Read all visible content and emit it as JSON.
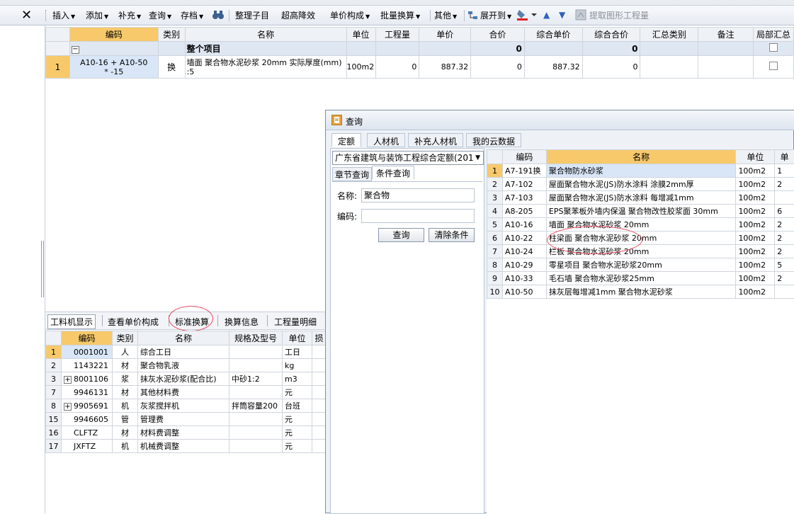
{
  "toolbar": {
    "items": [
      "插入",
      "添加",
      "补充",
      "查询",
      "存档",
      "整理子目",
      "超高降效",
      "单价构成",
      "批量换算",
      "其他",
      "展开到",
      "提取图形工程量"
    ]
  },
  "main_grid": {
    "headers": [
      "编码",
      "类别",
      "名称",
      "单位",
      "工程量",
      "单价",
      "合价",
      "综合单价",
      "综合合价",
      "汇总类别",
      "备注",
      "局部汇总"
    ],
    "group_row": {
      "name": "整个项目",
      "total": "0",
      "comp_total": "0"
    },
    "rows": [
      {
        "num": "1",
        "code_line1": "A10-16 + A10-50",
        "code_line2": "* -15",
        "type": "换",
        "name_line1": "墙面 聚合物水泥砂浆 20mm 实际厚度(mm)",
        "name_line2": ":5",
        "unit": "100m2",
        "qty": "0",
        "price": "887.32",
        "total": "0",
        "comp_price": "887.32",
        "comp_total": "0"
      }
    ]
  },
  "bottom_tabs": [
    "工料机显示",
    "查看单价构成",
    "标准换算",
    "换算信息",
    "工程量明细"
  ],
  "bottom_grid": {
    "headers": [
      "编码",
      "类别",
      "名称",
      "规格及型号",
      "单位",
      "损"
    ],
    "rows": [
      {
        "num": "1",
        "expand": "",
        "code": "0001001",
        "type": "人",
        "name": "综合工日",
        "spec": "",
        "unit": "工日"
      },
      {
        "num": "2",
        "expand": "",
        "code": "1143221",
        "type": "材",
        "name": "聚合物乳液",
        "spec": "",
        "unit": "kg"
      },
      {
        "num": "3",
        "expand": "+",
        "code": "8001106",
        "type": "浆",
        "name": "抹灰水泥砂浆(配合比)",
        "spec": "中砂1:2",
        "unit": "m3"
      },
      {
        "num": "7",
        "expand": "",
        "code": "9946131",
        "type": "材",
        "name": "其他材料费",
        "spec": "",
        "unit": "元"
      },
      {
        "num": "8",
        "expand": "+",
        "code": "9905691",
        "type": "机",
        "name": "灰浆搅拌机",
        "spec": "拌筒容量200",
        "unit": "台班"
      },
      {
        "num": "15",
        "expand": "",
        "code": "9946605",
        "type": "管",
        "name": "管理费",
        "spec": "",
        "unit": "元"
      },
      {
        "num": "16",
        "expand": "",
        "code": "CLFTZ",
        "type": "材",
        "name": "材料费调整",
        "spec": "",
        "unit": "元"
      },
      {
        "num": "17",
        "expand": "",
        "code": "JXFTZ",
        "type": "机",
        "name": "机械费调整",
        "spec": "",
        "unit": "元"
      }
    ]
  },
  "dialog": {
    "title": "查询",
    "tabs": [
      "定额",
      "人材机",
      "补充人材机",
      "我的云数据"
    ],
    "quota_select": "广东省建筑与装饰工程综合定额(201",
    "subtabs": [
      "章节查询",
      "条件查询"
    ],
    "name_label": "名称:",
    "name_value": "聚合物",
    "code_label": "编码:",
    "code_value": "",
    "search_button": "查询",
    "clear_button": "清除条件",
    "result_headers": [
      "编码",
      "名称",
      "单位",
      "单"
    ],
    "results": [
      {
        "num": "1",
        "code": "A7-191换",
        "name": "聚合物防水砂浆",
        "unit": "100m2",
        "extra": "1"
      },
      {
        "num": "2",
        "code": "A7-102",
        "name": "屋面聚合物水泥(JS)防水涂料 涂膜2mm厚",
        "unit": "100m2",
        "extra": "2"
      },
      {
        "num": "3",
        "code": "A7-103",
        "name": "屋面聚合物水泥(JS)防水涂料 每增减1mm",
        "unit": "100m2",
        "extra": ""
      },
      {
        "num": "4",
        "code": "A8-205",
        "name": "EPS聚苯板外墙内保温 聚合物改性胶浆面 30mm",
        "unit": "100m2",
        "extra": "6"
      },
      {
        "num": "5",
        "code": "A10-16",
        "name": "墙面 聚合物水泥砂浆 20mm",
        "unit": "100m2",
        "extra": "2"
      },
      {
        "num": "6",
        "code": "A10-22",
        "name": "柱梁面 聚合物水泥砂浆 20mm",
        "unit": "100m2",
        "extra": "2"
      },
      {
        "num": "7",
        "code": "A10-24",
        "name": "栏板 聚合物水泥砂浆 20mm",
        "unit": "100m2",
        "extra": "2"
      },
      {
        "num": "8",
        "code": "A10-29",
        "name": "零星项目 聚合物水泥砂浆20mm",
        "unit": "100m2",
        "extra": "5"
      },
      {
        "num": "9",
        "code": "A10-33",
        "name": "毛石墙 聚合物水泥砂浆25mm",
        "unit": "100m2",
        "extra": "2"
      },
      {
        "num": "10",
        "code": "A10-50",
        "name": "抹灰层每增减1mm 聚合物水泥砂浆",
        "unit": "100m2",
        "extra": ""
      }
    ]
  }
}
